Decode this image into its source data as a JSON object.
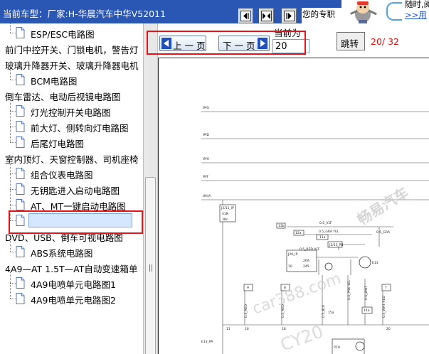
{
  "header": {
    "car_model_label": "当前车型：",
    "car_model_value": "厂家:H-华晨汽车中华V52011",
    "promo_text": "您的专职",
    "right_text": "随时,阅",
    "right_link": ">>用"
  },
  "tree": {
    "rows": [
      {
        "type": "leaf",
        "label": "ESP/ESC电路图"
      },
      {
        "type": "folder",
        "label": "前门中控开关、门锁电机，警告灯"
      },
      {
        "type": "folder",
        "label": "玻璃升降器开关、玻璃升降器电机"
      },
      {
        "type": "leaf",
        "label": "BCM电路图"
      },
      {
        "type": "folder",
        "label": "倒车雷达、电动后视镜电路图"
      },
      {
        "type": "leaf",
        "label": "灯光控制开关电路图"
      },
      {
        "type": "leaf",
        "label": "前大灯、侧转向灯电路图"
      },
      {
        "type": "leaf",
        "label": "后尾灯电路图"
      },
      {
        "type": "folder",
        "label": "室内顶灯、天窗控制器、司机座椅"
      },
      {
        "type": "leaf",
        "label": "组合仪表电路图"
      },
      {
        "type": "leaf",
        "label": "无钥匙进入启动电路图"
      },
      {
        "type": "leaf",
        "label": "AT、MT一键启动电路图",
        "selected": true
      },
      {
        "type": "leaf",
        "label": "电动助力转向EPS电路图"
      },
      {
        "type": "folder",
        "label": "DVD、USB、倒车可视电路图"
      },
      {
        "type": "leaf",
        "label": "ABS系统电路图"
      },
      {
        "type": "folder",
        "label": "4A9—AT 1.5T—AT自动变速箱单"
      },
      {
        "type": "leaf",
        "label": "4A9电喷单元电路图1"
      },
      {
        "type": "leaf",
        "label": "4A9电喷单元电路图2"
      }
    ]
  },
  "pager": {
    "prev_label": "上 一 页",
    "next_label": "下 一 页",
    "current_label": "当前为",
    "current_page": "20",
    "jump_label": "跳转",
    "page_count": "20/ 32"
  },
  "diagram": {
    "rail_labels": [
      "IP/G",
      "IP/D",
      "IP/H",
      "IP/F",
      "UH/A"
    ],
    "connector_labels": [
      "J3/11_IP",
      "41B",
      "38c",
      "13b",
      "12a",
      "0.5_VLT",
      "0.5_GRA YEL",
      "0.5_GRA",
      "11a",
      "0.5_RED VLT",
      "J2/13_PB",
      "J20_IP",
      "20A",
      "10",
      "245",
      "E13",
      "E13_PA",
      "9",
      "8",
      "7",
      "14a",
      "15a",
      "0.5_RED",
      "0.5_BLU",
      "0.5_PNK YEL",
      "0.5_WHT",
      "0.5_WHT RED",
      "PCU",
      "11",
      "16",
      "18",
      "20"
    ],
    "watermarks": [
      "畅易汽车",
      "car388.com",
      "CY20"
    ]
  },
  "colors": {
    "header_bg": "#2a56b4",
    "highlight_border": "#e0161b",
    "page_count_color": "#e01010",
    "nav_arrow_bg": "#1f4fc0"
  }
}
